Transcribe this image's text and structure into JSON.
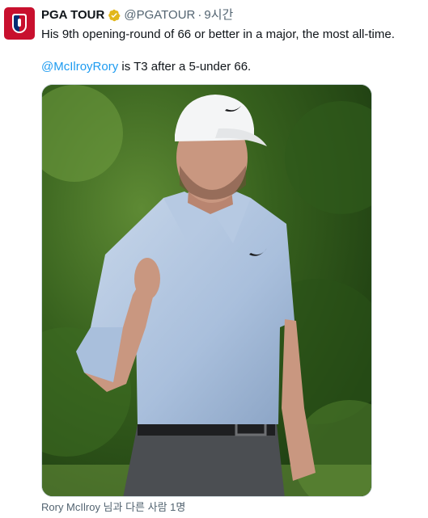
{
  "tweet": {
    "author_name": "PGA TOUR",
    "handle": "@PGATOUR",
    "separator": "·",
    "time": "9시간",
    "text_line1": "His 9th opening-round of 66 or better in a major, the most all-time.",
    "mention": "@McIlroyRory",
    "text_line2_rest": " is T3 after a 5-under 66.",
    "media_alt": "Rory McIlroy",
    "tagged_text": "Rory McIlroy 님과 다른 사람 1명"
  },
  "colors": {
    "accent": "#1d9bf0",
    "secondary_text": "#536471",
    "verified_badge": "#e2b719",
    "avatar_bg": "#c8102e"
  },
  "icons": {
    "avatar": "pga-tour-logo",
    "verified": "verified-badge-icon"
  }
}
